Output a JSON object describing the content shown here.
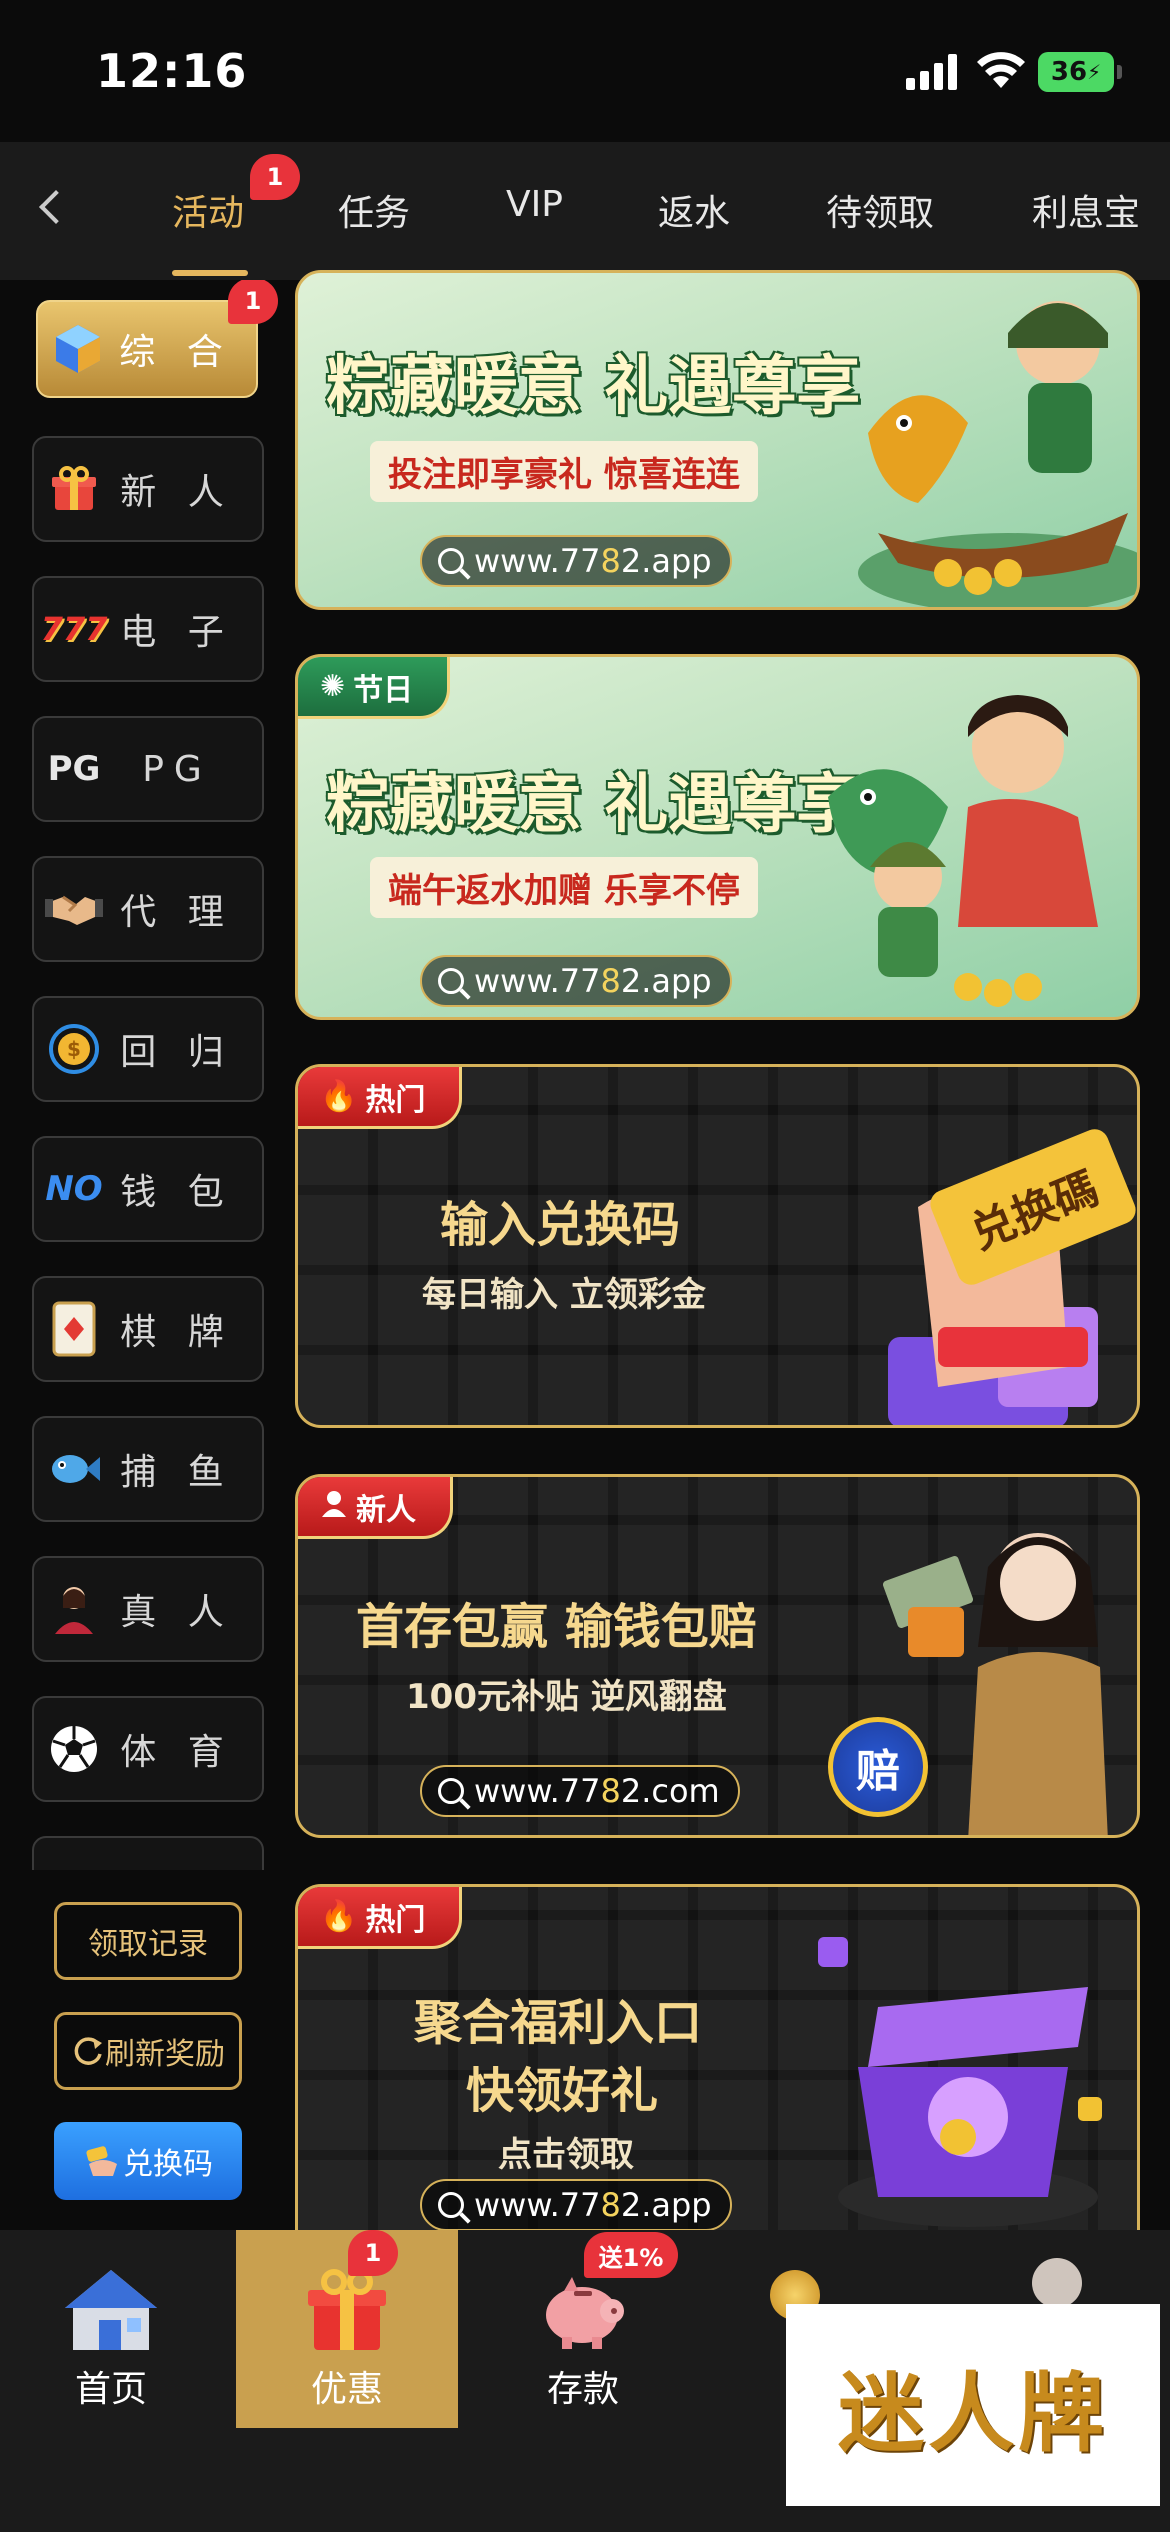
{
  "status_bar": {
    "time": "12:16",
    "battery": "36"
  },
  "top_tabs": [
    {
      "label": "活动",
      "badge": "1"
    },
    {
      "label": "任务"
    },
    {
      "label": "VIP"
    },
    {
      "label": "返水"
    },
    {
      "label": "待领取"
    },
    {
      "label": "利息宝"
    }
  ],
  "sidebar": {
    "items": [
      {
        "label": "综 合",
        "badge": "1",
        "icon": "cube-icon"
      },
      {
        "label": "新 人",
        "icon": "gift-icon"
      },
      {
        "label": "电 子",
        "icon": "slot-777-icon",
        "icon_text": "777"
      },
      {
        "label": "PG",
        "icon": "pg-logo-icon",
        "icon_text": "PG"
      },
      {
        "label": "代 理",
        "icon": "handshake-icon"
      },
      {
        "label": "回 归",
        "icon": "coin-return-icon"
      },
      {
        "label": "钱 包",
        "icon": "no-wallet-icon",
        "icon_text": "NO"
      },
      {
        "label": "棋 牌",
        "icon": "poker-card-icon"
      },
      {
        "label": "捕 鱼",
        "icon": "fish-icon"
      },
      {
        "label": "真 人",
        "icon": "dealer-icon"
      },
      {
        "label": "体 育",
        "icon": "soccer-ball-icon"
      }
    ],
    "buttons": {
      "records": "领取记录",
      "refresh": "刷新奖励",
      "redeem": "兑换码"
    }
  },
  "banners": [
    {
      "tag": "",
      "title": "粽藏暖意 礼遇尊享",
      "subtitle": "投注即享豪礼 惊喜连连",
      "url_prefix": "www.77",
      "url_hl": "8",
      "url_rest": "2.app"
    },
    {
      "tag": "节日",
      "title": "粽藏暖意 礼遇尊享",
      "subtitle": "端午返水加赠 乐享不停",
      "url_prefix": "www.77",
      "url_hl": "8",
      "url_rest": "2.app"
    },
    {
      "tag": "热门",
      "title": "输入兑换码",
      "subtitle": "每日输入 立领彩金",
      "art_text": "兑换碼"
    },
    {
      "tag": "新人",
      "title": "首存包赢  输钱包赔",
      "subtitle": "100元补贴 逆风翻盘",
      "url_prefix": "www.77",
      "url_hl": "8",
      "url_rest": "2.com",
      "art_text": "赔"
    },
    {
      "tag": "热门",
      "title_line1": "聚合福利入口",
      "title_line2": "快领好礼",
      "subtitle": "点击领取",
      "url_prefix": "www.77",
      "url_hl": "8",
      "url_rest": "2.app"
    }
  ],
  "bottom_nav": [
    {
      "label": "首页",
      "icon": "house-icon"
    },
    {
      "label": "优惠",
      "badge": "1",
      "icon": "gift-box-icon"
    },
    {
      "label": "存款",
      "badge": "送1%",
      "icon": "piggy-bank-icon"
    }
  ],
  "watermark": "迷人牌"
}
